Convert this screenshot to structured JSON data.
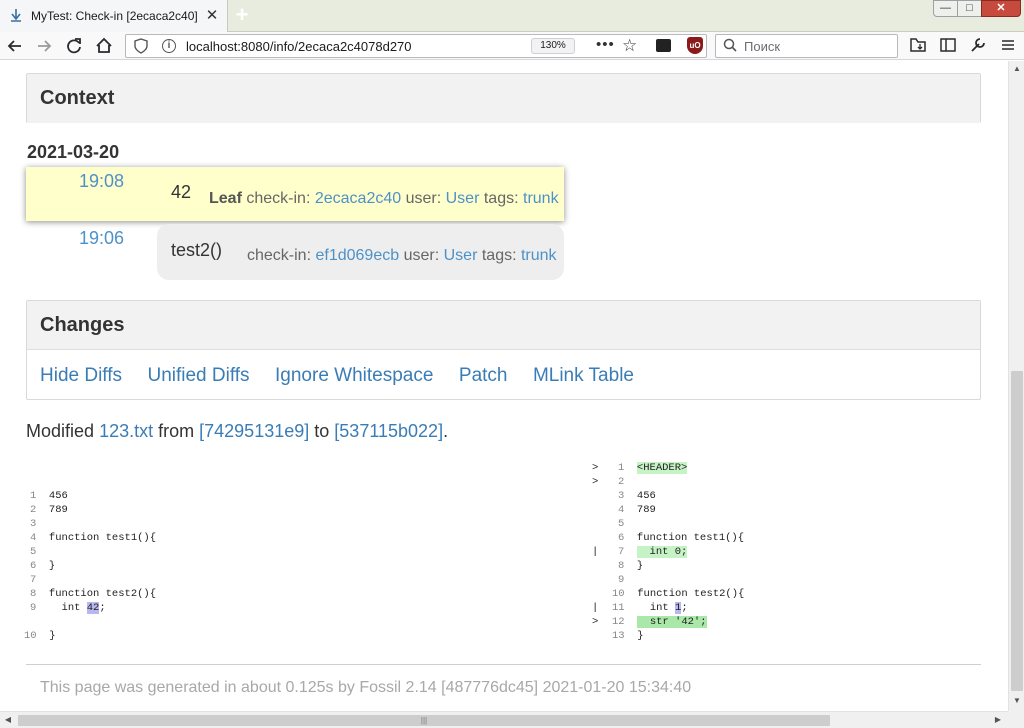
{
  "browser": {
    "tab_title": "MyTest: Check-in [2ecaca2c40]",
    "close_glyph": "✕",
    "new_tab_glyph": "+",
    "url": "localhost:8080/info/2ecaca2c4078d270",
    "zoom": "130%",
    "search_placeholder": "Поиск",
    "page_actions_glyph": "•••",
    "ext_ublock_label": "uO"
  },
  "window_controls": {
    "minimize": "—",
    "maximize": "□",
    "close": "✕"
  },
  "context": {
    "heading": "Context"
  },
  "timeline": {
    "date": "2021-03-20",
    "entries": [
      {
        "time": "19:08",
        "comment": "42",
        "leaf": "Leaf",
        "checkin_label": "check-in:",
        "checkin": "2ecaca2c40",
        "user_label": "user:",
        "user": "User",
        "tags_label": "tags:",
        "tags": "trunk"
      },
      {
        "time": "19:06",
        "comment": "test2()",
        "checkin_label": "check-in:",
        "checkin": "ef1d069ecb",
        "user_label": "user:",
        "user": "User",
        "tags_label": "tags:",
        "tags": "trunk"
      }
    ]
  },
  "changes": {
    "heading": "Changes",
    "links": [
      "Hide Diffs",
      "Unified Diffs",
      "Ignore Whitespace",
      "Patch",
      "MLink Table"
    ]
  },
  "modified": {
    "prefix": "Modified",
    "file": "123.txt",
    "from_label": "from",
    "from": "[74295131e9]",
    "to_label": "to",
    "to": "[537115b022]",
    "end": "."
  },
  "diff": {
    "left": [
      {
        "n": "1",
        "text": "456"
      },
      {
        "n": "2",
        "text": "789"
      },
      {
        "n": "3",
        "text": ""
      },
      {
        "n": "4",
        "text": "function test1(){"
      },
      {
        "n": "5",
        "text": ""
      },
      {
        "n": "6",
        "text": "}"
      },
      {
        "n": "7",
        "text": ""
      },
      {
        "n": "8",
        "text": "function test2(){"
      },
      {
        "n": "9",
        "pre": "  int ",
        "hl": "42",
        "post": ";"
      },
      {
        "n": "10",
        "text": "}"
      }
    ],
    "markers": [
      ">",
      ">",
      "|",
      "|",
      ">"
    ],
    "right": [
      {
        "n": "1",
        "hl_full": "<HEADER>"
      },
      {
        "n": "2",
        "text": ""
      },
      {
        "n": "3",
        "text": "456"
      },
      {
        "n": "4",
        "text": "789"
      },
      {
        "n": "5",
        "text": ""
      },
      {
        "n": "6",
        "text": "function test1(){"
      },
      {
        "n": "7",
        "hl_full": "  int 0;"
      },
      {
        "n": "8",
        "text": "}"
      },
      {
        "n": "9",
        "text": ""
      },
      {
        "n": "10",
        "text": "function test2(){"
      },
      {
        "n": "11",
        "pre": "  int ",
        "hl": "1",
        "post": ";"
      },
      {
        "n": "12",
        "hl_full": "  str '42';"
      },
      {
        "n": "13",
        "text": "}"
      }
    ]
  },
  "footer": "This page was generated in about 0.125s by Fossil 2.14 [487776dc45] 2021-01-20 15:34:40",
  "scrollbar": {
    "thumb_grip": "|||"
  }
}
